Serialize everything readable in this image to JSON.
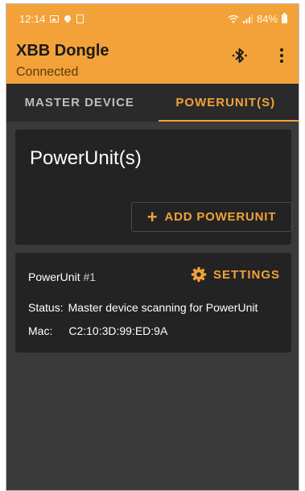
{
  "status_bar": {
    "time": "12:14",
    "battery": "84%"
  },
  "app_bar": {
    "title": "XBB Dongle",
    "subtitle": "Connected",
    "icons": [
      "bluetooth-searching-icon",
      "more-vert-icon"
    ]
  },
  "tabs": [
    {
      "label": "MASTER DEVICE",
      "active": false
    },
    {
      "label": "POWERUNIT(S)",
      "active": true
    }
  ],
  "header_card": {
    "title": "PowerUnit(s)",
    "add_button_label": "ADD POWERUNIT"
  },
  "power_units": [
    {
      "name": "PowerUnit",
      "number": "#1",
      "settings_label": "SETTINGS",
      "status_label": "Status:",
      "status_value": "Master device scanning for PowerUnit",
      "mac_label": "Mac:",
      "mac_value": "C2:10:3D:99:ED:9A"
    }
  ],
  "colors": {
    "accent": "#f2a238",
    "background": "#3a3a3a",
    "card": "#232323"
  }
}
